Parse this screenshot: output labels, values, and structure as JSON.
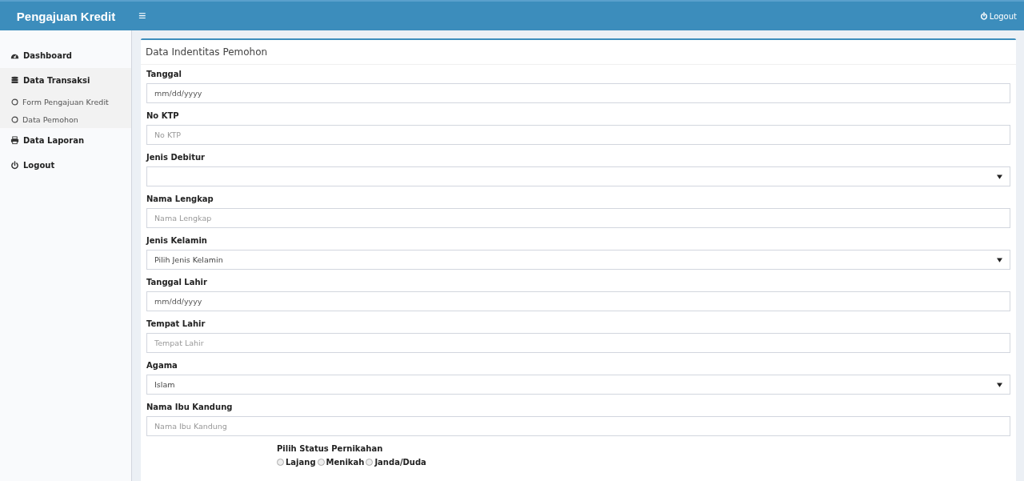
{
  "header": {
    "brand": "Pengajuan Kredit",
    "menu_glyph": "≡",
    "logout": "Logout"
  },
  "sidebar": {
    "items": [
      {
        "label": "Dashboard"
      },
      {
        "label": "Data Transaksi",
        "expanded": true,
        "children": [
          {
            "label": "Form Pengajuan Kredit"
          },
          {
            "label": "Data Pemohon"
          }
        ]
      },
      {
        "label": "Data Laporan"
      },
      {
        "label": "Logout"
      }
    ]
  },
  "form": {
    "title": "Data Indentitas Pemohon",
    "fields": [
      {
        "kind": "date",
        "label": "Tanggal",
        "placeholder": "mm/dd/yyyy"
      },
      {
        "kind": "text",
        "label": "No KTP",
        "placeholder": "No KTP"
      },
      {
        "kind": "select",
        "label": "Jenis Debitur"
      },
      {
        "kind": "text",
        "label": "Nama Lengkap",
        "placeholder": "Nama Lengkap"
      },
      {
        "kind": "select",
        "label": "Jenis Kelamin",
        "value": "Pilih Jenis Kelamin"
      },
      {
        "kind": "date",
        "label": "Tanggal Lahir",
        "placeholder": "mm/dd/yyyy"
      },
      {
        "kind": "text",
        "label": "Tempat Lahir",
        "placeholder": "Tempat Lahir"
      },
      {
        "kind": "select",
        "label": "Agama",
        "value": "Islam"
      },
      {
        "kind": "text",
        "label": "Nama Ibu Kandung",
        "placeholder": "Nama Ibu Kandung"
      }
    ],
    "marital": {
      "label": "Pilih Status Pernikahan",
      "options": [
        {
          "label": "Lajang",
          "selected": false
        },
        {
          "label": "Menikah",
          "selected": false
        },
        {
          "label": "Janda/Duda",
          "selected": false
        }
      ]
    }
  }
}
